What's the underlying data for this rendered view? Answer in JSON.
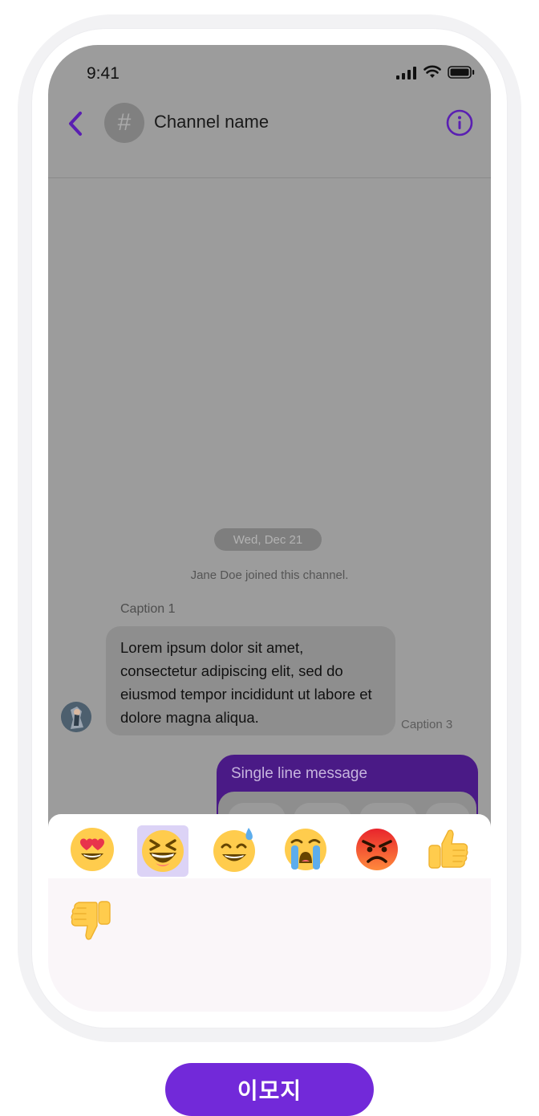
{
  "status_bar": {
    "time": "9:41"
  },
  "header": {
    "channel_name": "Channel name",
    "channel_glyph": "#"
  },
  "conversation": {
    "date_separator": "Wed, Dec 21",
    "system_message": "Jane Doe joined this channel.",
    "incoming": {
      "caption_top": "Caption 1",
      "text": "Lorem ipsum dolor sit amet, consectetur adipiscing elit, sed do eiusmod tempor incididunt ut labore et dolore magna aliqua.",
      "caption_side": "Caption 3"
    },
    "outgoing": {
      "text": "Single line message"
    }
  },
  "emoji_picker": {
    "selected_index": 1,
    "emojis": [
      "heart-eyes-emoji",
      "laughing-emoji",
      "sweat-smile-emoji",
      "crying-emoji",
      "angry-emoji",
      "thumbs-up-emoji",
      "thumbs-down-emoji"
    ]
  },
  "bottom_label": "이모지",
  "colors": {
    "accent": "#7229d9",
    "header_icon": "#5a1fb2",
    "selected_emoji_bg": "#dcd3f6",
    "outgoing_bubble": "#4a1a86"
  }
}
